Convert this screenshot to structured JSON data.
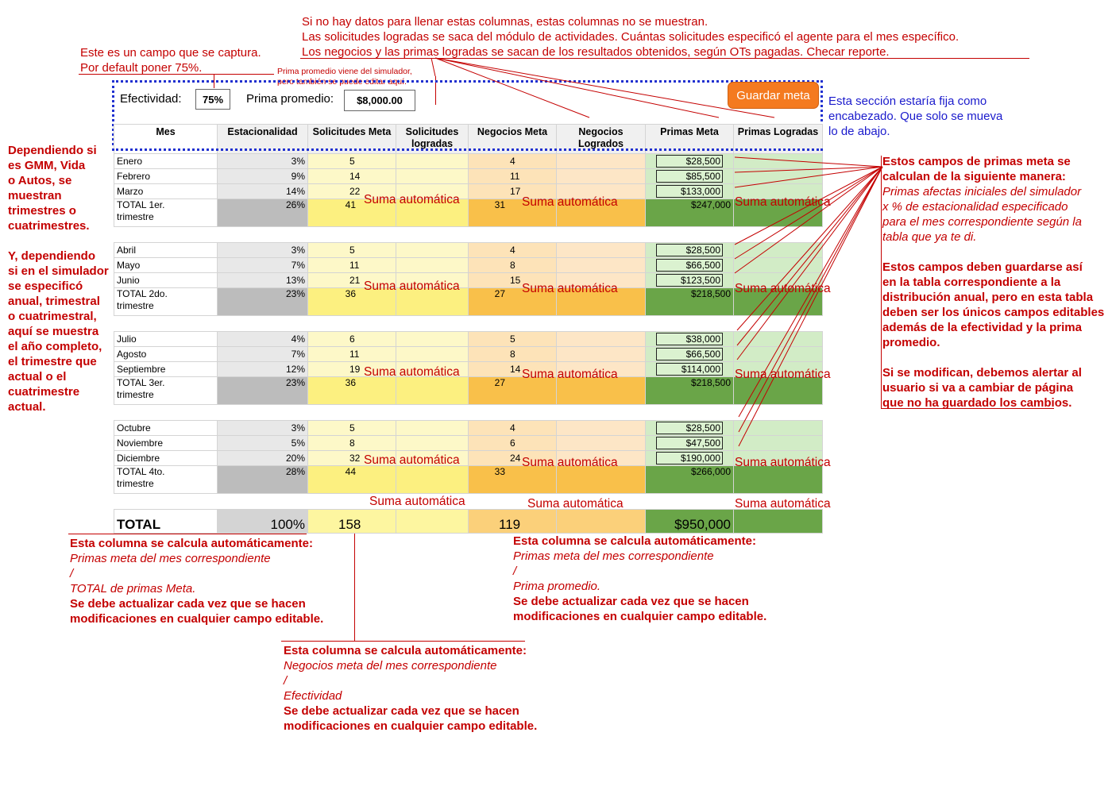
{
  "header": {
    "efectividad_label": "Efectividad:",
    "efectividad_value": "75%",
    "prima_label": "Prima promedio:",
    "prima_value": "$8,000.00",
    "save_button": "Guardar meta"
  },
  "columns": [
    "Mes",
    "Estacionalidad",
    "Solicitudes Meta",
    "Solicitudes logradas",
    "Negocios Meta",
    "Negocios Logrados",
    "Primas Meta",
    "Primas Logradas"
  ],
  "quarters": [
    {
      "months": [
        {
          "mes": "Enero",
          "est": "3%",
          "sol": "5",
          "neg": "4",
          "pri": "$28,500"
        },
        {
          "mes": "Febrero",
          "est": "9%",
          "sol": "14",
          "neg": "11",
          "pri": "$85,500"
        },
        {
          "mes": "Marzo",
          "est": "14%",
          "sol": "22",
          "neg": "17",
          "pri": "$133,000"
        }
      ],
      "total": {
        "line1": "TOTAL 1er.",
        "line2": "trimestre",
        "est": "26%",
        "sol": "41",
        "neg": "31",
        "pri": "$247,000"
      }
    },
    {
      "months": [
        {
          "mes": "Abril",
          "est": "3%",
          "sol": "5",
          "neg": "4",
          "pri": "$28,500"
        },
        {
          "mes": "Mayo",
          "est": "7%",
          "sol": "11",
          "neg": "8",
          "pri": "$66,500"
        },
        {
          "mes": "Junio",
          "est": "13%",
          "sol": "21",
          "neg": "15",
          "pri": "$123,500"
        }
      ],
      "total": {
        "line1": "TOTAL 2do.",
        "line2": "trimestre",
        "est": "23%",
        "sol": "36",
        "neg": "27",
        "pri": "$218,500"
      }
    },
    {
      "months": [
        {
          "mes": "Julio",
          "est": "4%",
          "sol": "6",
          "neg": "5",
          "pri": "$38,000"
        },
        {
          "mes": "Agosto",
          "est": "7%",
          "sol": "11",
          "neg": "8",
          "pri": "$66,500"
        },
        {
          "mes": "Septiembre",
          "est": "12%",
          "sol": "19",
          "neg": "14",
          "pri": "$114,000"
        }
      ],
      "total": {
        "line1": "TOTAL 3er.",
        "line2": "trimestre",
        "est": "23%",
        "sol": "36",
        "neg": "27",
        "pri": "$218,500"
      }
    },
    {
      "months": [
        {
          "mes": "Octubre",
          "est": "3%",
          "sol": "5",
          "neg": "4",
          "pri": "$28,500"
        },
        {
          "mes": "Noviembre",
          "est": "5%",
          "sol": "8",
          "neg": "6",
          "pri": "$47,500"
        },
        {
          "mes": "Diciembre",
          "est": "20%",
          "sol": "32",
          "neg": "24",
          "pri": "$190,000"
        }
      ],
      "total": {
        "line1": "TOTAL 4to.",
        "line2": "trimestre",
        "est": "28%",
        "sol": "44",
        "neg": "33",
        "pri": "$266,000"
      }
    }
  ],
  "grand_total": {
    "label": "TOTAL",
    "est": "100%",
    "sol": "158",
    "neg": "119",
    "pri": "$950,000"
  },
  "auto_label": "Suma automática",
  "notes": {
    "top_line1": "Si no hay datos para llenar estas columnas, estas columnas no se muestran.",
    "top_line2": "Las solicitudes logradas se saca del módulo de actividades. Cuántas solicitudes especificó el agente para el mes específico.",
    "top_line3": "Los negocios y las primas logradas se sacan de los resultados obtenidos, según OTs pagadas. Checar reporte.",
    "efect_line1": "Este es un campo que se captura.",
    "efect_line2": "Por default poner 75%.",
    "prima_line1": "Prima promedio viene del simulador,",
    "prima_line2": "pero también se puede editar aquí.",
    "fixed_line1": "Esta sección estaría fija como",
    "fixed_line2": "encabezado. Que solo se mueva",
    "fixed_line3": "lo de abajo.",
    "left_line1": "Dependiendo si",
    "left_line2": "es GMM, Vida",
    "left_line3": "o Autos, se",
    "left_line4": "muestran",
    "left_line5": "trimestres o",
    "left_line6": "cuatrimestres.",
    "left_line7": "Y, dependiendo",
    "left_line8": "si en el simulador",
    "left_line9": "se especificó",
    "left_line10": "anual, trimestral",
    "left_line11": "o cuatrimestral,",
    "left_line12": "aquí se muestra",
    "left_line13": "el año completo,",
    "left_line14": "el trimestre que",
    "left_line15": "actual o el",
    "left_line16": "cuatrimestre",
    "left_line17": "actual.",
    "right_line1": "Estos campos de primas meta se",
    "right_line2": "calculan de la siguiente manera:",
    "right_line3": "Primas afectas iniciales del simulador",
    "right_line4": "x % de estacionalidad especificado",
    "right_line5": "para el mes correspondiente según la",
    "right_line6": "tabla que ya te di.",
    "right_line7": "Estos campos deben guardarse así",
    "right_line8": "en la tabla correspondiente a la",
    "right_line9": "distribución anual, pero en esta tabla",
    "right_line10": "deben ser los únicos campos editables",
    "right_line11": "además de la efectividad y la prima",
    "right_line12": "promedio.",
    "right_line13": "Si se modifican, debemos alertar al",
    "right_line14": "usuario si va a cambiar de página",
    "right_line15": "que no ha guardado los cambios.",
    "est_line1": "Esta columna se calcula automáticamente:",
    "est_line2": "Primas meta del mes correspondiente",
    "est_line3": "/",
    "est_line4": "TOTAL de primas Meta.",
    "est_line5": "Se debe actualizar cada vez que se hacen",
    "est_line6": "modificaciones en cualquier campo editable.",
    "sol_line1": "Esta columna se calcula automáticamente:",
    "sol_line2": "Negocios meta del mes correspondiente",
    "sol_line3": "/",
    "sol_line4": "Efectividad",
    "sol_line5": "Se debe actualizar cada vez que se hacen",
    "sol_line6": "modificaciones en cualquier campo editable.",
    "neg_line1": "Esta columna se calcula automáticamente:",
    "neg_line2": "Primas meta del mes correspondiente",
    "neg_line3": "/",
    "neg_line4": "Prima promedio.",
    "neg_line5": "Se debe actualizar cada vez que se hacen",
    "neg_line6": "modificaciones en cualquier campo editable."
  },
  "colors": {
    "annotation_red": "#c40000",
    "annotation_blue": "#1a1acc",
    "button_orange": "#f47a1f"
  }
}
